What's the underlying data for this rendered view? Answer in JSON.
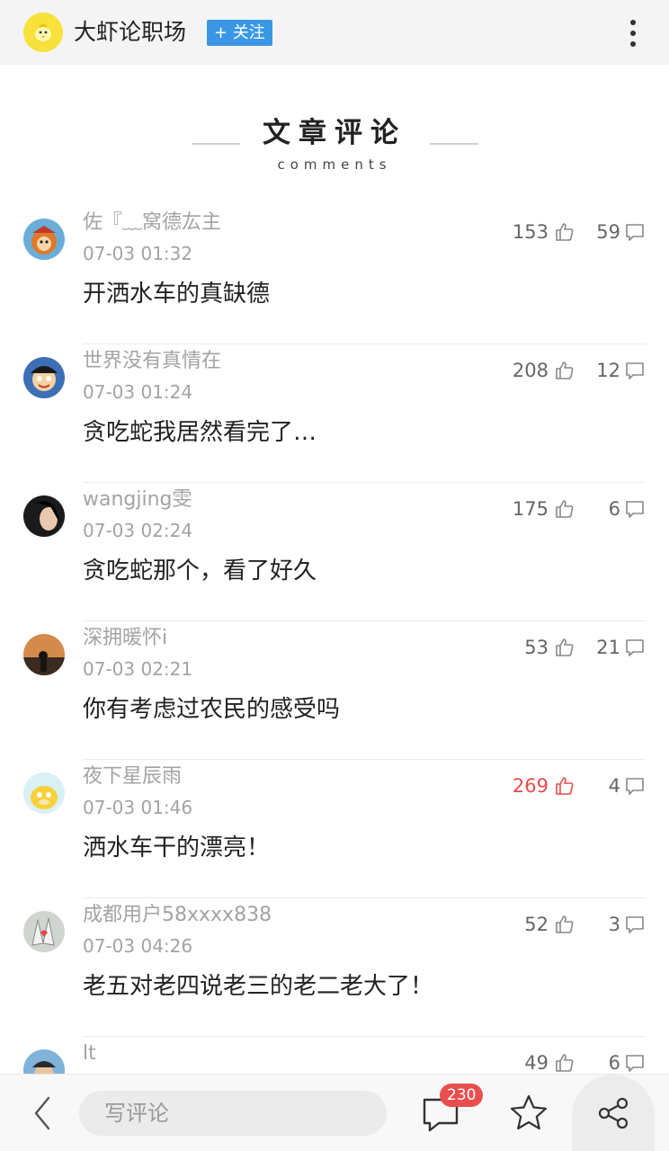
{
  "header": {
    "account_name": "大虾论职场",
    "follow_label": "+ 关注"
  },
  "section": {
    "title": "文章评论",
    "subtitle": "comments"
  },
  "comments": [
    {
      "user": "佐『﹏窝德厷主",
      "time": "07-03 01:32",
      "text": "开洒水车的真缺德",
      "likes": "153",
      "replies": "59"
    },
    {
      "user": "世界没有真情在",
      "time": "07-03 01:24",
      "text": "贪吃蛇我居然看完了…",
      "likes": "208",
      "replies": "12"
    },
    {
      "user": "wangjing雯",
      "time": "07-03 02:24",
      "text": "贪吃蛇那个，看了好久",
      "likes": "175",
      "replies": "6"
    },
    {
      "user": "深拥暖怀i",
      "time": "07-03 02:21",
      "text": "你有考虑过农民的感受吗",
      "likes": "53",
      "replies": "21"
    },
    {
      "user": "夜下星辰雨",
      "time": "07-03 01:46",
      "text": "洒水车干的漂亮！",
      "likes": "269",
      "replies": "4",
      "liked": true
    },
    {
      "user": "成都用户58xxxx838",
      "time": "07-03 04:26",
      "text": "老五对老四说老三的老二老大了！",
      "likes": "52",
      "replies": "3"
    },
    {
      "user": "lt",
      "time": "",
      "text": "",
      "likes": "49",
      "replies": "6"
    }
  ],
  "bottom_bar": {
    "input_placeholder": "写评论",
    "comment_count": "230"
  },
  "colors": {
    "accent_blue": "#3a97e5",
    "hot_red": "#e94b4b",
    "badge_red": "#e84e4e",
    "meta_gray": "#a3a3a3"
  },
  "icons": [
    "back-icon",
    "comment-icon",
    "star-icon",
    "share-icon",
    "thumbs-up-icon",
    "reply-bubble-icon",
    "more-icon"
  ]
}
